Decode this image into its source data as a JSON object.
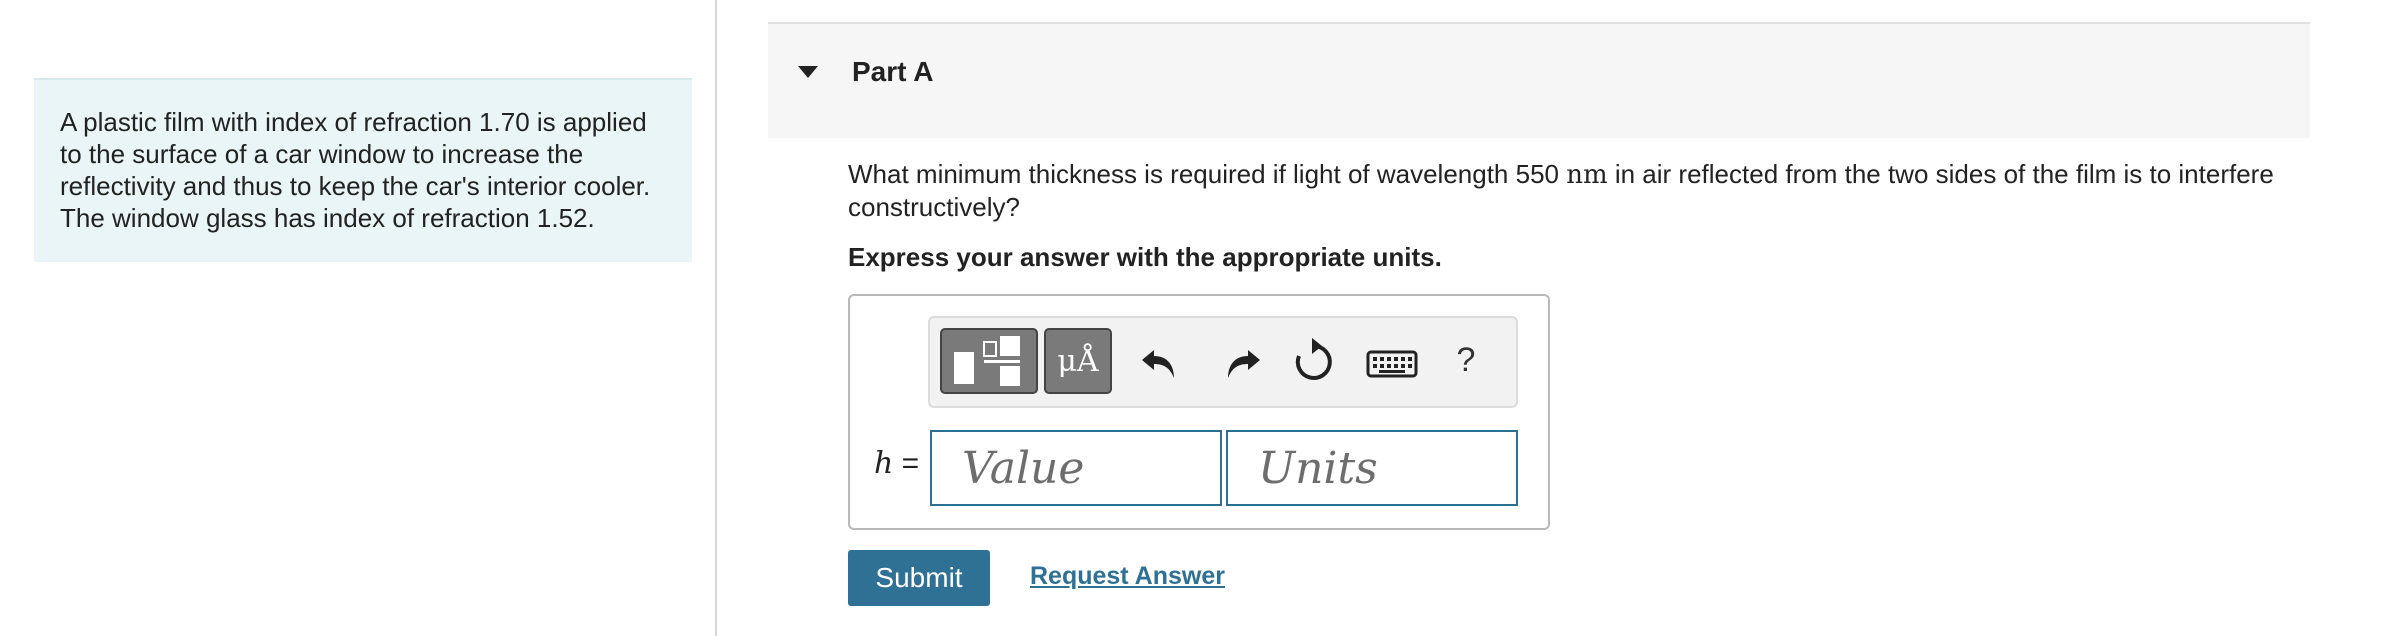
{
  "problem": {
    "text": "A plastic film with index of refraction 1.70 is applied to the surface of a car window to increase the reflectivity and thus to keep the car's interior cooler. The window glass has index of refraction 1.52."
  },
  "part": {
    "title": "Part A",
    "toggle_icon": "caret-down-icon",
    "question_before": "What minimum thickness is required if light of wavelength 550 ",
    "question_unit": "nm",
    "question_after": " in air reflected from the two sides of the film is to interfere constructively?",
    "instructions": "Express your answer with the appropriate units."
  },
  "toolbar": {
    "templates_icon": "templates-icon",
    "symbols_label": "μÅ",
    "undo_icon": "undo-icon",
    "redo_icon": "redo-icon",
    "reset_icon": "reset-icon",
    "keyboard_icon": "keyboard-icon",
    "help_label": "?"
  },
  "answer": {
    "variable": "h",
    "equals": " =",
    "value_placeholder": "Value",
    "units_placeholder": "Units"
  },
  "actions": {
    "submit_label": "Submit",
    "request_answer_label": "Request Answer"
  },
  "colors": {
    "accent": "#2f7195",
    "problem_bg": "#e9f5f7",
    "header_bg": "#f6f6f6"
  }
}
